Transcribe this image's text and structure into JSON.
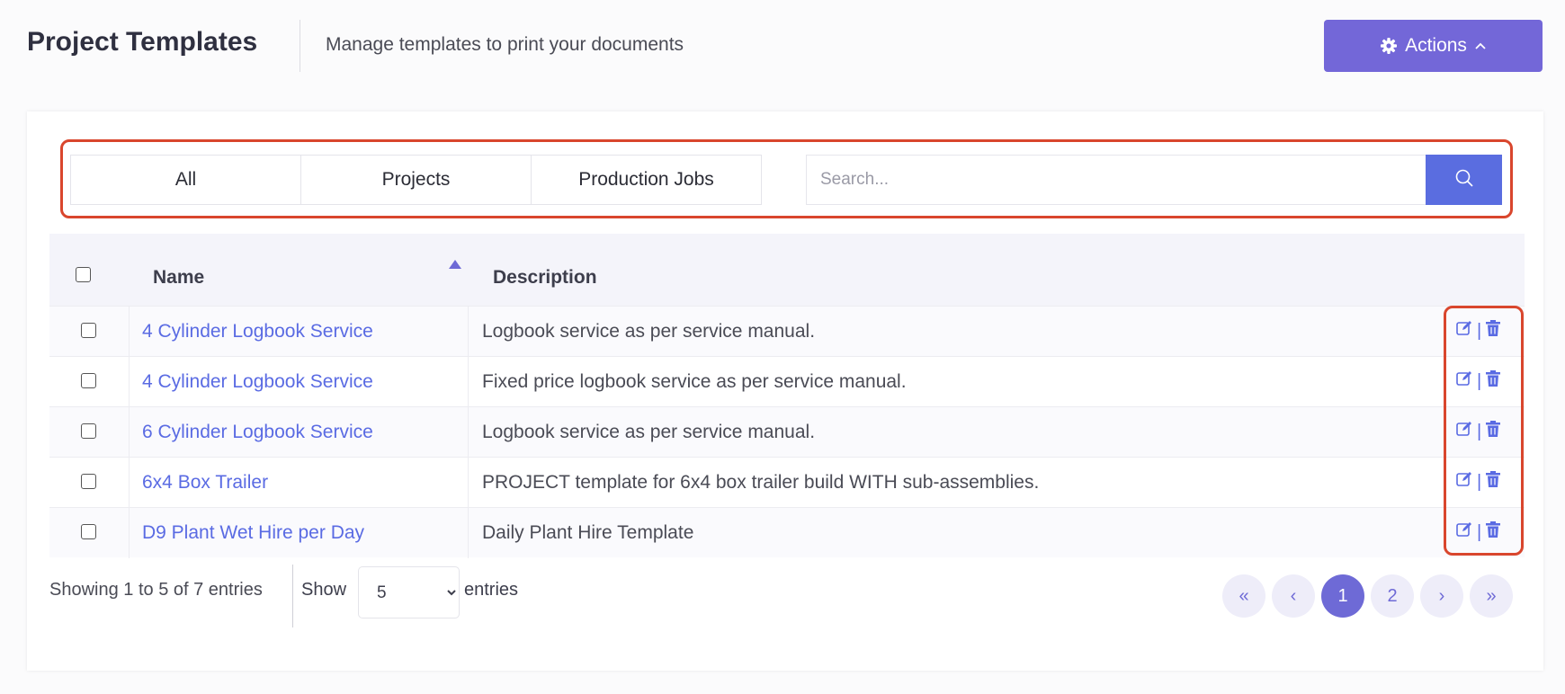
{
  "header": {
    "title": "Project Templates",
    "subtitle": "Manage templates to print your documents",
    "actions_label": "Actions"
  },
  "filters": {
    "tabs": [
      {
        "label": "All"
      },
      {
        "label": "Projects"
      },
      {
        "label": "Production Jobs"
      }
    ],
    "search_placeholder": "Search..."
  },
  "table": {
    "columns": {
      "name": "Name",
      "description": "Description"
    },
    "rows": [
      {
        "name": "4 Cylinder Logbook Service",
        "description": "Logbook service as per service manual."
      },
      {
        "name": "4 Cylinder Logbook Service",
        "description": "Fixed price logbook service as per service manual."
      },
      {
        "name": "6 Cylinder Logbook Service",
        "description": "Logbook service as per service manual."
      },
      {
        "name": "6x4 Box Trailer",
        "description": "PROJECT template for 6x4 box trailer build WITH sub-assemblies."
      },
      {
        "name": "D9 Plant Wet Hire per Day",
        "description": "Daily Plant Hire Template"
      }
    ],
    "row_action_separator": "|"
  },
  "footer": {
    "info": "Showing 1 to 5 of 7 entries",
    "show_label": "Show",
    "page_length": "5",
    "entries_label": "entries"
  },
  "pagination": {
    "first": "«",
    "prev": "‹",
    "pages": [
      "1",
      "2"
    ],
    "current_page": "1",
    "next": "›",
    "last": "»"
  },
  "colors": {
    "accent": "#7367d8",
    "link": "#5a6be3",
    "search_button": "#5a6de0",
    "highlight_border": "#d9462d"
  },
  "icons": {
    "actions": "gear-icon",
    "actions_caret": "chevron-up-icon",
    "search": "search-icon",
    "row_edit": "edit-icon",
    "row_delete": "trash-icon",
    "sort": "sort-asc-icon"
  }
}
